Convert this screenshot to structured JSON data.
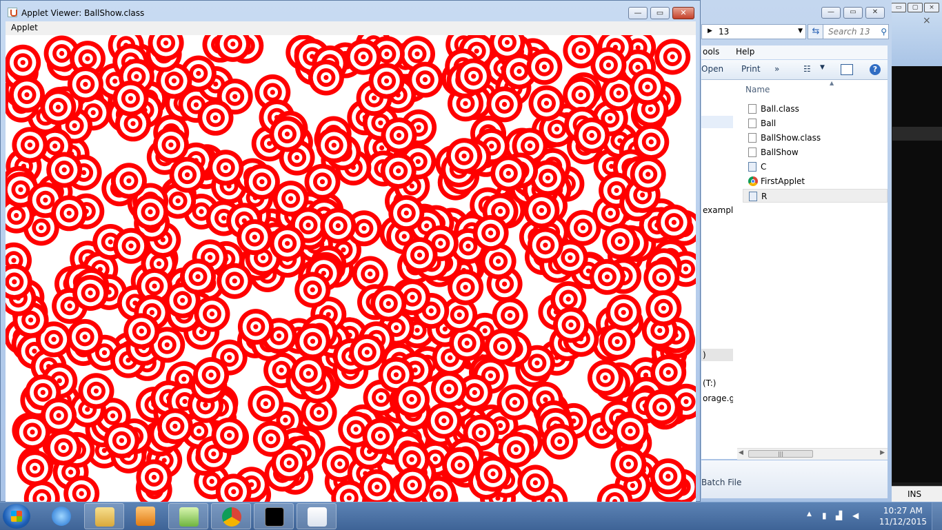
{
  "applet": {
    "title": "Applet Viewer: BallShow.class",
    "menu": "Applet",
    "ring_color": "#ff0000"
  },
  "explorer": {
    "address": "13",
    "search_placeholder": "Search 13",
    "menu": {
      "tools": "ools",
      "help": "Help"
    },
    "toolbar": {
      "open": "Open",
      "print": "Print",
      "more": "»"
    },
    "nav": {
      "example": "example",
      "drive": "(T:)",
      "storage": "orage.gu",
      "bracket": ")"
    },
    "column_header": "Name",
    "files": [
      {
        "name": "Ball.class",
        "icon": "file-icon"
      },
      {
        "name": "Ball",
        "icon": "text-file-icon"
      },
      {
        "name": "BallShow.class",
        "icon": "file-icon"
      },
      {
        "name": "BallShow",
        "icon": "text-file-icon"
      },
      {
        "name": "C",
        "icon": "cmd-file-icon"
      },
      {
        "name": "FirstApplet",
        "icon": "chrome-icon"
      },
      {
        "name": "R",
        "icon": "cmd-file-icon"
      }
    ],
    "selected_file": "R",
    "details": "Batch File"
  },
  "console": {
    "status": "INS"
  },
  "taskbar": {
    "items": [
      "internet-explorer-icon",
      "file-explorer-icon",
      "media-player-icon",
      "notepad-plus-icon",
      "chrome-icon",
      "cmd-icon",
      "java-icon"
    ],
    "time": "10:27 AM",
    "date": "11/12/2015"
  }
}
